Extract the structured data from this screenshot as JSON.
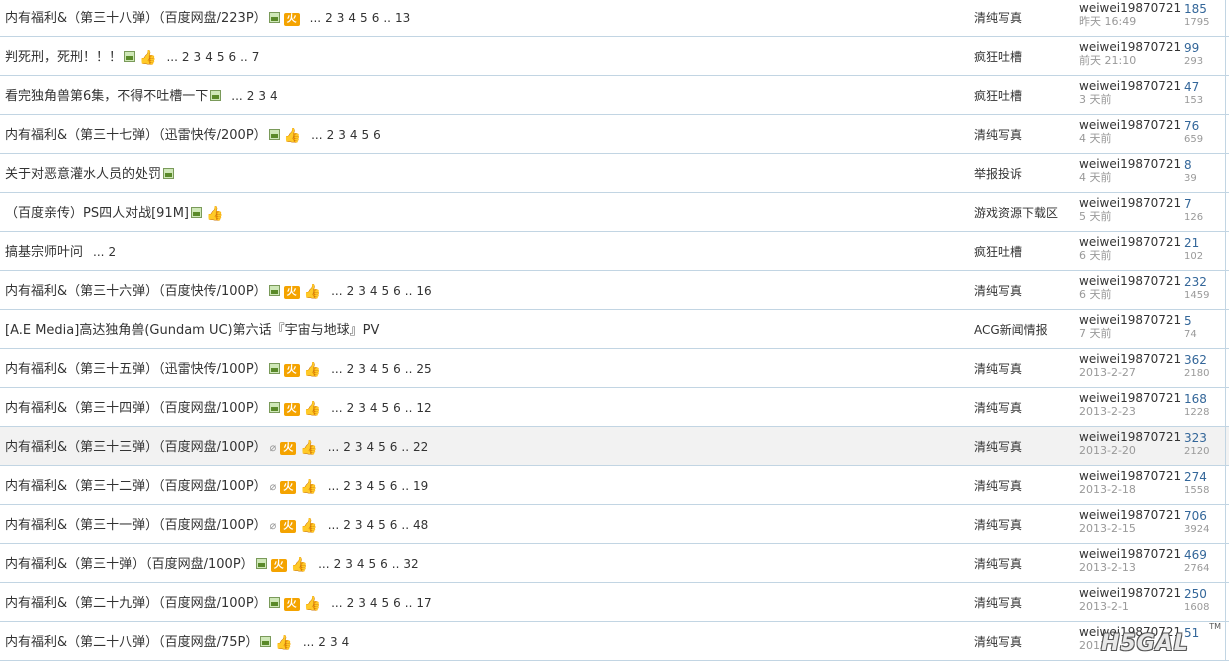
{
  "threads": [
    {
      "title": "内有福利&（第三十八弹）（百度网盘/223P）",
      "icons": [
        "img",
        "hot"
      ],
      "pages": [
        "...",
        "2",
        "3",
        "4",
        "5",
        "6",
        "..",
        "13"
      ],
      "forum": "清纯写真",
      "author": "weiwei19870721",
      "date": "昨天 16:49",
      "replies": "185",
      "views": "1795"
    },
    {
      "title": "判死刑，死刑！！！",
      "icons": [
        "img",
        "thumb"
      ],
      "pages": [
        "...",
        "2",
        "3",
        "4",
        "5",
        "6",
        "..",
        "7"
      ],
      "forum": "疯狂吐槽",
      "author": "weiwei19870721",
      "date": "前天 21:10",
      "replies": "99",
      "views": "293"
    },
    {
      "title": "看完独角兽第6集，不得不吐槽一下",
      "icons": [
        "img"
      ],
      "pages": [
        "...",
        "2",
        "3",
        "4"
      ],
      "forum": "疯狂吐槽",
      "author": "weiwei19870721",
      "date": "3 天前",
      "replies": "47",
      "views": "153"
    },
    {
      "title": "内有福利&（第三十七弹）（迅雷快传/200P）",
      "icons": [
        "img",
        "thumb"
      ],
      "pages": [
        "...",
        "2",
        "3",
        "4",
        "5",
        "6"
      ],
      "forum": "清纯写真",
      "author": "weiwei19870721",
      "date": "4 天前",
      "replies": "76",
      "views": "659"
    },
    {
      "title": "关于对恶意灌水人员的处罚",
      "icons": [
        "img"
      ],
      "pages": [],
      "forum": "举报投诉",
      "author": "weiwei19870721",
      "date": "4 天前",
      "replies": "8",
      "views": "39"
    },
    {
      "title": "（百度亲传）PS四人对战[91M]",
      "icons": [
        "img",
        "thumb"
      ],
      "pages": [],
      "forum": "游戏资源下载区",
      "author": "weiwei19870721",
      "date": "5 天前",
      "replies": "7",
      "views": "126"
    },
    {
      "title": "搞基宗师叶问",
      "icons": [],
      "pages": [
        "...",
        "2"
      ],
      "forum": "疯狂吐槽",
      "author": "weiwei19870721",
      "date": "6 天前",
      "replies": "21",
      "views": "102"
    },
    {
      "title": "内有福利&（第三十六弹）（百度快传/100P）",
      "icons": [
        "img",
        "hot",
        "thumb"
      ],
      "pages": [
        "...",
        "2",
        "3",
        "4",
        "5",
        "6",
        "..",
        "16"
      ],
      "forum": "清纯写真",
      "author": "weiwei19870721",
      "date": "6 天前",
      "replies": "232",
      "views": "1459"
    },
    {
      "title": "[A.E Media]高达独角兽(Gundam UC)第六话『宇宙与地球』PV",
      "icons": [],
      "pages": [],
      "forum": "ACG新闻情报",
      "author": "weiwei19870721",
      "date": "7 天前",
      "replies": "5",
      "views": "74"
    },
    {
      "title": "内有福利&（第三十五弹）（迅雷快传/100P）",
      "icons": [
        "img",
        "hot",
        "thumb"
      ],
      "pages": [
        "...",
        "2",
        "3",
        "4",
        "5",
        "6",
        "..",
        "25"
      ],
      "forum": "清纯写真",
      "author": "weiwei19870721",
      "date": "2013-2-27",
      "replies": "362",
      "views": "2180"
    },
    {
      "title": "内有福利&（第三十四弹）（百度网盘/100P）",
      "icons": [
        "img",
        "hot",
        "thumb"
      ],
      "pages": [
        "...",
        "2",
        "3",
        "4",
        "5",
        "6",
        "..",
        "12"
      ],
      "forum": "清纯写真",
      "author": "weiwei19870721",
      "date": "2013-2-23",
      "replies": "168",
      "views": "1228"
    },
    {
      "title": "内有福利&（第三十三弹）（百度网盘/100P）",
      "icons": [
        "clip",
        "hot",
        "thumb"
      ],
      "pages": [
        "...",
        "2",
        "3",
        "4",
        "5",
        "6",
        "..",
        "22"
      ],
      "forum": "清纯写真",
      "author": "weiwei19870721",
      "date": "2013-2-20",
      "replies": "323",
      "views": "2120",
      "highlight": true
    },
    {
      "title": "内有福利&（第三十二弹）（百度网盘/100P）",
      "icons": [
        "clip",
        "hot",
        "thumb"
      ],
      "pages": [
        "...",
        "2",
        "3",
        "4",
        "5",
        "6",
        "..",
        "19"
      ],
      "forum": "清纯写真",
      "author": "weiwei19870721",
      "date": "2013-2-18",
      "replies": "274",
      "views": "1558"
    },
    {
      "title": "内有福利&（第三十一弹）（百度网盘/100P）",
      "icons": [
        "clip",
        "hot",
        "thumb"
      ],
      "pages": [
        "...",
        "2",
        "3",
        "4",
        "5",
        "6",
        "..",
        "48"
      ],
      "forum": "清纯写真",
      "author": "weiwei19870721",
      "date": "2013-2-15",
      "replies": "706",
      "views": "3924"
    },
    {
      "title": "内有福利&（第三十弹）（百度网盘/100P）",
      "icons": [
        "img",
        "hot",
        "thumb"
      ],
      "pages": [
        "...",
        "2",
        "3",
        "4",
        "5",
        "6",
        "..",
        "32"
      ],
      "forum": "清纯写真",
      "author": "weiwei19870721",
      "date": "2013-2-13",
      "replies": "469",
      "views": "2764"
    },
    {
      "title": "内有福利&（第二十九弹）（百度网盘/100P）",
      "icons": [
        "img",
        "hot",
        "thumb"
      ],
      "pages": [
        "...",
        "2",
        "3",
        "4",
        "5",
        "6",
        "..",
        "17"
      ],
      "forum": "清纯写真",
      "author": "weiwei19870721",
      "date": "2013-2-1",
      "replies": "250",
      "views": "1608"
    },
    {
      "title": "内有福利&（第二十八弹）（百度网盘/75P）",
      "icons": [
        "img",
        "thumb"
      ],
      "pages": [
        "...",
        "2",
        "3",
        "4"
      ],
      "forum": "清纯写真",
      "author": "weiwei19870721",
      "date": "2013",
      "replies": "51",
      "views": ""
    }
  ],
  "icon_labels": {
    "hot": "火",
    "thumb": "👍",
    "clip": "⌀"
  },
  "logo": {
    "text": "H5GAL",
    "tm": "TM"
  },
  "colors": {
    "border": "#c2d5e3",
    "reply": "#336699",
    "muted": "#999999",
    "hot": "#f4a300"
  }
}
